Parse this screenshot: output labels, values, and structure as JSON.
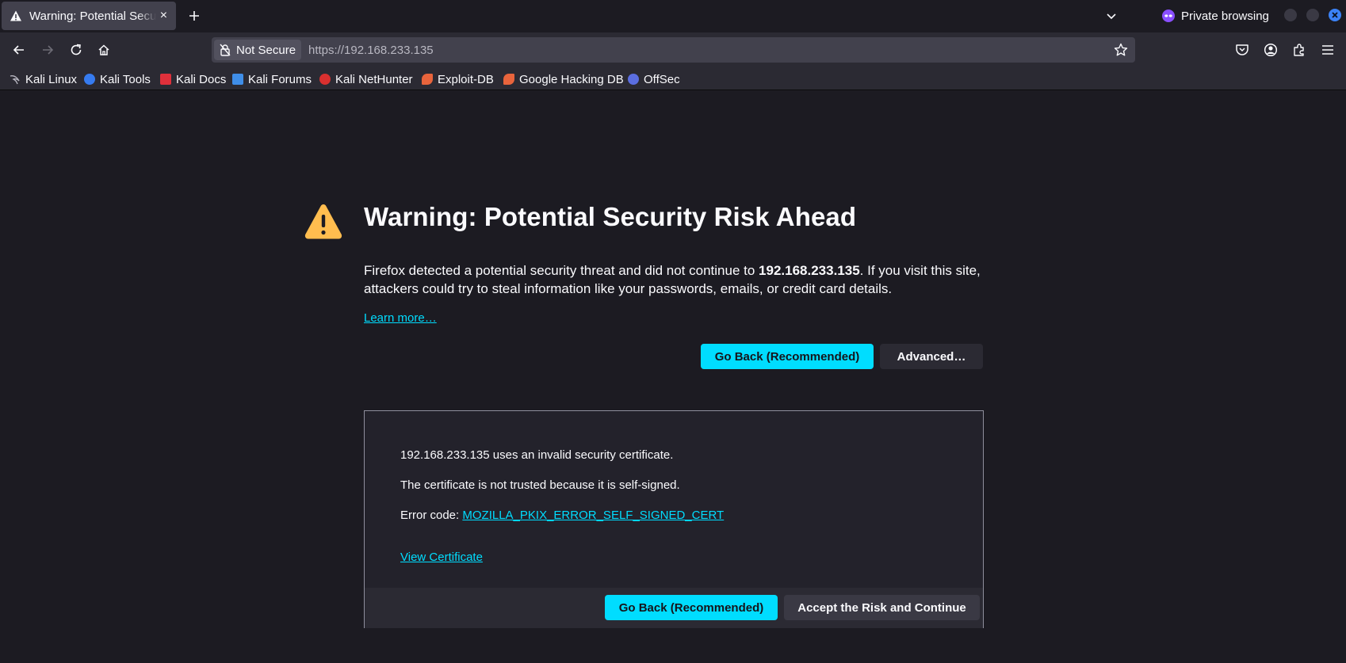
{
  "tab": {
    "title": "Warning: Potential Security Risk Ahead",
    "close": "×"
  },
  "private": {
    "label": "Private browsing"
  },
  "urlbar": {
    "not_secure": "Not Secure",
    "url": "https://192.168.233.135"
  },
  "bookmarks": [
    {
      "label": "Kali Linux",
      "icon": "kali-dragon-icon",
      "color": "#b8b7c1"
    },
    {
      "label": "Kali Tools",
      "icon": "kali-tools-icon",
      "color": "#367bf0"
    },
    {
      "label": "Kali Docs",
      "icon": "kali-docs-icon",
      "color": "#e0303b"
    },
    {
      "label": "Kali Forums",
      "icon": "kali-forums-icon",
      "color": "#3f8ee8"
    },
    {
      "label": "Kali NetHunter",
      "icon": "nethunter-icon",
      "color": "#d9302f"
    },
    {
      "label": "Exploit-DB",
      "icon": "exploit-db-icon",
      "color": "#e8643c"
    },
    {
      "label": "Google Hacking DB",
      "icon": "ghdb-icon",
      "color": "#e8643c"
    },
    {
      "label": "OffSec",
      "icon": "offsec-icon",
      "color": "#5b6ee1"
    }
  ],
  "page": {
    "title": "Warning: Potential Security Risk Ahead",
    "desc_before": "Firefox detected a potential security threat and did not continue to ",
    "desc_host": "192.168.233.135",
    "desc_after": ". If you visit this site, attackers could try to steal information like your passwords, emails, or credit card details.",
    "learn_more": "Learn more…",
    "go_back": "Go Back (Recommended)",
    "advanced": "Advanced…"
  },
  "advanced_panel": {
    "line1": "192.168.233.135 uses an invalid security certificate.",
    "line2": "The certificate is not trusted because it is self-signed.",
    "error_label": "Error code: ",
    "error_code": "MOZILLA_PKIX_ERROR_SELF_SIGNED_CERT",
    "view_certificate": "View Certificate",
    "go_back": "Go Back (Recommended)",
    "accept": "Accept the Risk and Continue"
  },
  "colors": {
    "accent": "#00ddff",
    "warning": "#ffbd4f",
    "background": "#1c1b22"
  }
}
